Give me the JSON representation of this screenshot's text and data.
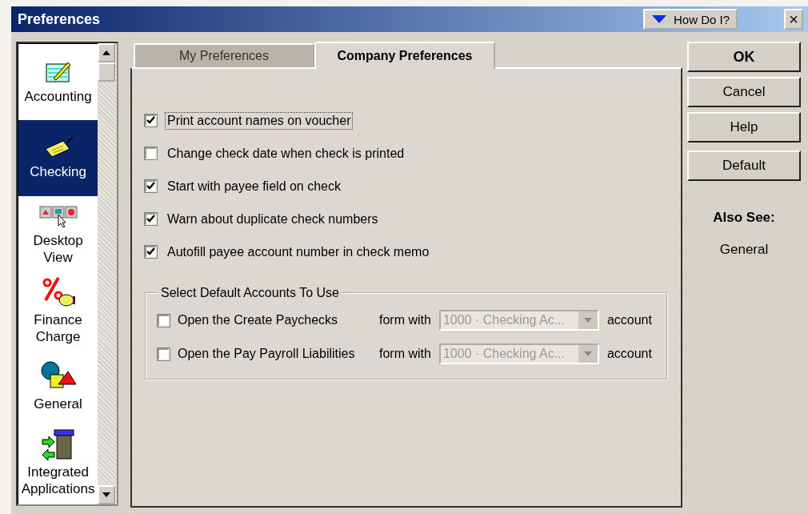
{
  "window": {
    "title": "Preferences",
    "help_button": "How Do I?",
    "close_button": "×"
  },
  "sidebar": {
    "items": [
      {
        "label": "Accounting",
        "selected": false
      },
      {
        "label": "Checking",
        "selected": true
      },
      {
        "label": "Desktop View",
        "selected": false
      },
      {
        "label": "Finance Charge",
        "selected": false
      },
      {
        "label": "General",
        "selected": false
      },
      {
        "label": "Integrated Applications",
        "selected": false
      }
    ]
  },
  "tabs": [
    {
      "label": "My Preferences",
      "selected": false
    },
    {
      "label": "Company Preferences",
      "selected": true
    }
  ],
  "options": [
    {
      "label": "Print account names on voucher",
      "checked": true,
      "focused": true
    },
    {
      "label": "Change check date when check is printed",
      "checked": false,
      "focused": false
    },
    {
      "label": "Start with payee field on check",
      "checked": true,
      "focused": false
    },
    {
      "label": "Warn about duplicate check numbers",
      "checked": true,
      "focused": false
    },
    {
      "label": "Autofill payee account number in check memo",
      "checked": true,
      "focused": false
    }
  ],
  "default_accounts": {
    "title": "Select Default Accounts To Use",
    "rows": [
      {
        "label": "Open the Create Paychecks",
        "checked": false,
        "connector": "form with",
        "account": "1000 · Checking Ac...",
        "suffix": "account",
        "disabled": true
      },
      {
        "label": "Open the Pay Payroll Liabilities",
        "checked": false,
        "connector": "form with",
        "account": "1000 · Checking Ac...",
        "suffix": "account",
        "disabled": true
      }
    ]
  },
  "buttons": [
    {
      "label": "OK",
      "default": true
    },
    {
      "label": "Cancel",
      "default": false
    },
    {
      "label": "Help",
      "default": false
    },
    {
      "label": "Default",
      "default": false
    }
  ],
  "also_see": {
    "title": "Also See:",
    "links": [
      "General"
    ]
  }
}
